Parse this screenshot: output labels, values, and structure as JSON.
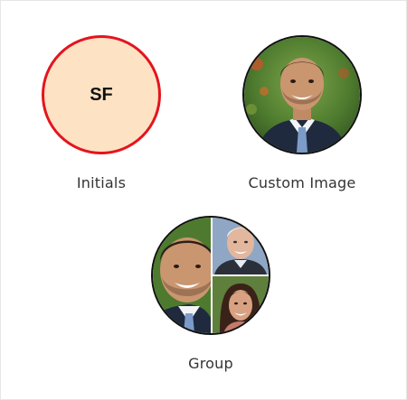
{
  "avatars": {
    "initials": {
      "text": "SF",
      "caption": "Initials",
      "border_color": "#e4141e",
      "background_color": "#fde2c4"
    },
    "custom_image": {
      "caption": "Custom Image",
      "image": "smiling-man-photo"
    },
    "group": {
      "caption": "Group",
      "images": [
        "smiling-man-photo",
        "older-man-photo",
        "smiling-woman-photo"
      ]
    }
  }
}
